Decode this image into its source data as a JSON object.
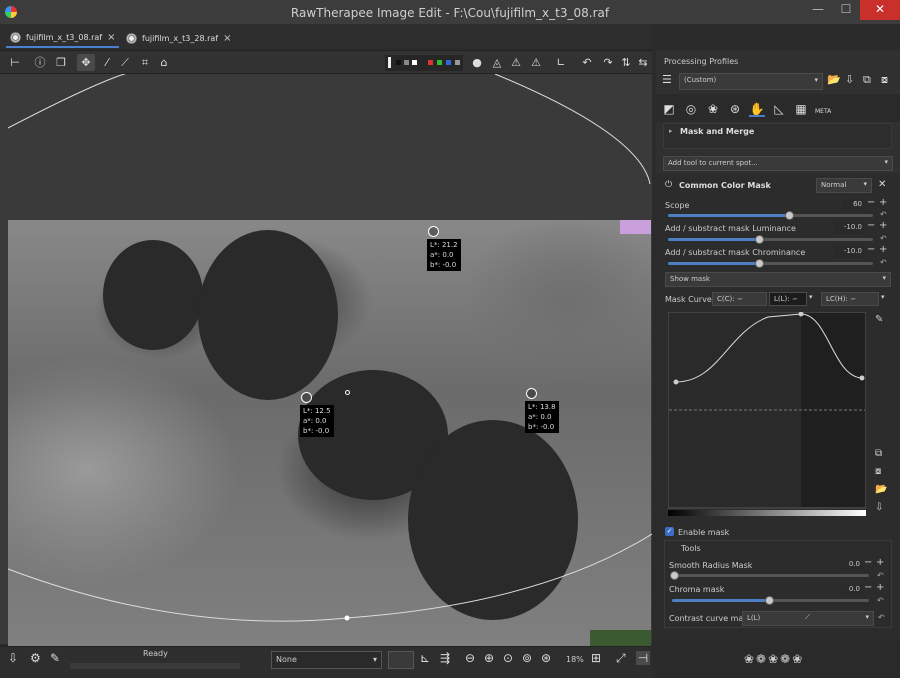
{
  "window": {
    "title": "RawTherapee Image Edit - F:\\Cou\\fujifilm_x_t3_08.raf",
    "minimize": "—",
    "maximize": "☐",
    "close": "✕"
  },
  "tabs": [
    {
      "label": "fujifilm_x_t3_08.raf",
      "close": "×"
    },
    {
      "label": "fujifilm_x_t3_28.raf",
      "close": "×"
    }
  ],
  "image": {
    "readouts": [
      {
        "L": "L*: 21.2",
        "a": "a*: 0.0",
        "b": "b*: -0.0"
      },
      {
        "L": "L*: 12.5",
        "a": "a*: 0.0",
        "b": "b*: -0.0"
      },
      {
        "L": "L*: 13.8",
        "a": "a*: 0.0",
        "b": "b*: -0.0"
      }
    ]
  },
  "toolbar": {
    "rotate_left_label": "90",
    "rotate_right_label": "90"
  },
  "bottom": {
    "status": "Ready",
    "output_profile": "None",
    "zoom": "18%"
  },
  "panel": {
    "processing_profiles": "Processing Profiles",
    "profile_value": "(Custom)",
    "mask_and_merge": "Mask and Merge",
    "add_tool": "Add tool to current spot...",
    "common_color_mask": "Common Color Mask",
    "blend_mode": "Normal",
    "scope": {
      "label": "Scope",
      "value": "60",
      "fraction": 0.6
    },
    "lum_mask": {
      "label": "Add / substract mask Luminance",
      "value": "-10.0",
      "fraction": 0.45
    },
    "chrom_mask": {
      "label": "Add / substract mask Chrominance",
      "value": "-10.0",
      "fraction": 0.45
    },
    "show_mask": "Show mask",
    "mask_curves": "Mask Curves:",
    "curve_tabs": [
      "C(C):",
      "L(L):",
      "LC(H):"
    ],
    "enable_mask": "Enable mask",
    "tools": "Tools",
    "smooth_radius": {
      "label": "Smooth Radius Mask",
      "value": "0.0",
      "fraction": 0.0
    },
    "chroma_mask": {
      "label": "Chroma mask",
      "value": "0.0",
      "fraction": 0.5
    },
    "contrast_curve": {
      "label": "Contrast curve mask:",
      "value": "L(L)"
    },
    "meta_label": "META"
  }
}
